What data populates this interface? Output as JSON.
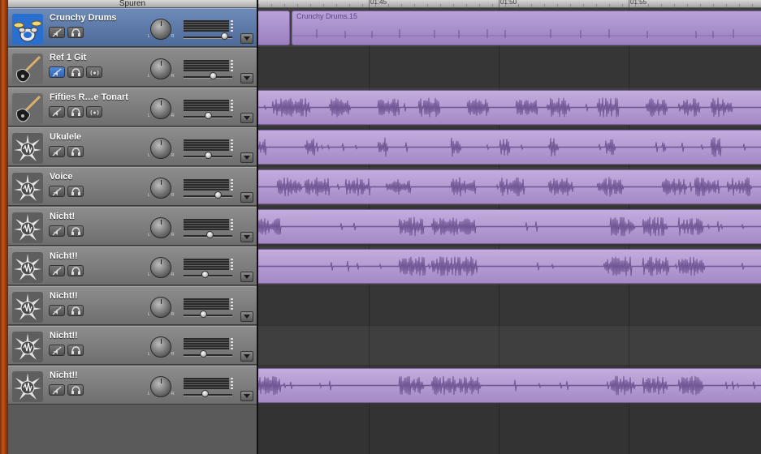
{
  "header": {
    "title": "Spuren"
  },
  "ruler": {
    "labels": [
      "01:45",
      "01:50",
      "01:55"
    ]
  },
  "tracks": [
    {
      "name": "Crunchy Drums",
      "icon": "drum-kit-icon",
      "selected": true,
      "has_third_button": false,
      "volume": 0.83
    },
    {
      "name": "Ref 1 Git",
      "icon": "electric-guitar-icon",
      "selected": false,
      "has_third_button": true,
      "mute_active": true,
      "volume": 0.6
    },
    {
      "name": "Fifties R…e Tonart",
      "icon": "electric-guitar-icon",
      "selected": false,
      "has_third_button": true,
      "volume": 0.5
    },
    {
      "name": "Ukulele",
      "icon": "waveform-star-icon",
      "selected": false,
      "has_third_button": false,
      "volume": 0.5
    },
    {
      "name": "Voice",
      "icon": "waveform-star-icon",
      "selected": false,
      "has_third_button": false,
      "volume": 0.7
    },
    {
      "name": "Nicht!",
      "icon": "waveform-star-icon",
      "selected": false,
      "has_third_button": false,
      "volume": 0.53
    },
    {
      "name": "Nicht!!",
      "icon": "waveform-star-icon",
      "selected": false,
      "has_third_button": false,
      "volume": 0.43
    },
    {
      "name": "Nicht!!",
      "icon": "waveform-star-icon",
      "selected": false,
      "has_third_button": false,
      "volume": 0.4
    },
    {
      "name": "Nicht!!",
      "icon": "waveform-star-icon",
      "selected": false,
      "has_third_button": false,
      "volume": 0.4
    },
    {
      "name": "Nicht!!",
      "icon": "waveform-star-icon",
      "selected": false,
      "has_third_button": false,
      "volume": 0.43
    }
  ],
  "regions": [
    {
      "track": 0,
      "label": "Crunchy Drums.15",
      "kind": "midi"
    },
    {
      "track": 2,
      "label": "",
      "kind": "audio"
    },
    {
      "track": 3,
      "label": "",
      "kind": "audio"
    },
    {
      "track": 4,
      "label": "",
      "kind": "audio"
    },
    {
      "track": 5,
      "label": "",
      "kind": "audio"
    },
    {
      "track": 6,
      "label": "",
      "kind": "audio"
    },
    {
      "track": 9,
      "label": "",
      "kind": "audio"
    }
  ],
  "colors": {
    "region": "#a58ac6",
    "selected_track": "#5b79a8",
    "wood": "#b04a12"
  }
}
